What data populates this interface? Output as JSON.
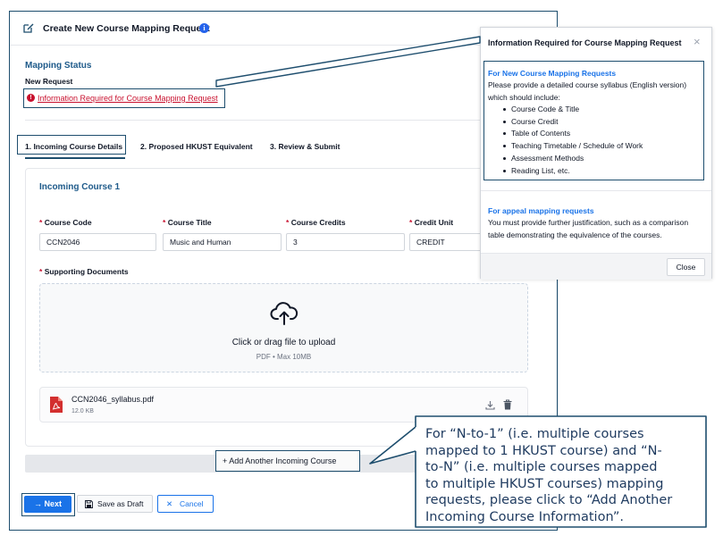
{
  "header": {
    "title": "Create New Course Mapping Request",
    "info_icon": "info-icon",
    "edit_icon": "edit-icon"
  },
  "status": {
    "section_title": "Mapping Status",
    "state": "New Request",
    "info_link": "Information Required for Course Mapping Request"
  },
  "tabs": [
    {
      "label": "1. Incoming Course Details",
      "active": true
    },
    {
      "label": "2. Proposed HKUST Equivalent",
      "active": false
    },
    {
      "label": "3. Review & Submit",
      "active": false
    }
  ],
  "course_card": {
    "title": "Incoming Course 1",
    "required_mark": "*",
    "fields": [
      {
        "label": "Course Code",
        "value": "CCN2046"
      },
      {
        "label": "Course Title",
        "value": "Music and Human"
      },
      {
        "label": "Course Credits",
        "value": "3"
      },
      {
        "label": "Credit Unit",
        "value": "CREDIT"
      }
    ],
    "docs_label": "Supporting Documents",
    "upload_text": "Click or drag file to upload",
    "upload_hint": "PDF • Max 10MB",
    "file": {
      "name": "CCN2046_syllabus.pdf",
      "size": "12.0 KB"
    }
  },
  "add_button": {
    "icon": "+",
    "label": "Add Another Incoming Course"
  },
  "footer": {
    "next_label": "Next",
    "next_icon": "→",
    "draft_label": "Save as Draft",
    "cancel_label": "Cancel",
    "cancel_icon": "✕"
  },
  "popover": {
    "title": "Information Required for Course Mapping Request",
    "close_icon": "×",
    "section1_title": "For New Course Mapping Requests",
    "section1_intro_line1": "Please provide a detailed course syllabus (English version)",
    "section1_intro_line2": "which should include:",
    "items": [
      "Course Code & Title",
      "Course Credit",
      "Table of Contents",
      "Teaching Timetable / Schedule of Work",
      "Assessment Methods",
      "Reading List, etc."
    ],
    "section2_title": "For appeal mapping requests",
    "section2_line1": "You must provide further justification, such as a comparison",
    "section2_line2": "table demonstrating the equivalence of the courses.",
    "close_button": "Close"
  },
  "callout": {
    "lines": [
      "For “N-to-1” (i.e. multiple courses",
      "mapped to 1 HKUST course) and “N-",
      "to-N” (i.e. multiple courses mapped",
      "to multiple HKUST courses) mapping",
      "requests, please click to “Add Another",
      "Incoming Course Information”."
    ]
  },
  "colors": {
    "accent": "#1a73e8",
    "heading": "#1e5a8a",
    "error": "#c8102e",
    "annotation": "#1e4e6e"
  }
}
